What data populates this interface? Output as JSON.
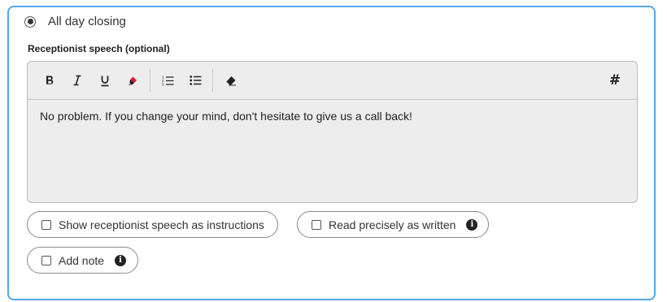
{
  "closing_option": {
    "label": "All day closing",
    "selected": true
  },
  "speech_field": {
    "label": "Receptionist speech (optional)",
    "content": "No problem. If you change your mind, don't hesitate to give us a call back!"
  },
  "toolbar": {
    "icons": [
      "bold-icon",
      "italic-icon",
      "underline-icon",
      "highlight-icon",
      "numbered-list-icon",
      "bullet-list-icon",
      "eraser-icon",
      "hash-icon"
    ],
    "hash_label": "#",
    "highlight_color": "#e0182d"
  },
  "options": {
    "show_as_instructions": {
      "label": "Show receptionist speech as instructions",
      "checked": false
    },
    "read_precisely": {
      "label": "Read precisely as written",
      "checked": false,
      "info": "i"
    },
    "add_note": {
      "label": "Add note",
      "checked": false,
      "info": "i"
    }
  },
  "colors": {
    "border_accent": "#56a6e6",
    "editor_bg": "#ededed"
  }
}
